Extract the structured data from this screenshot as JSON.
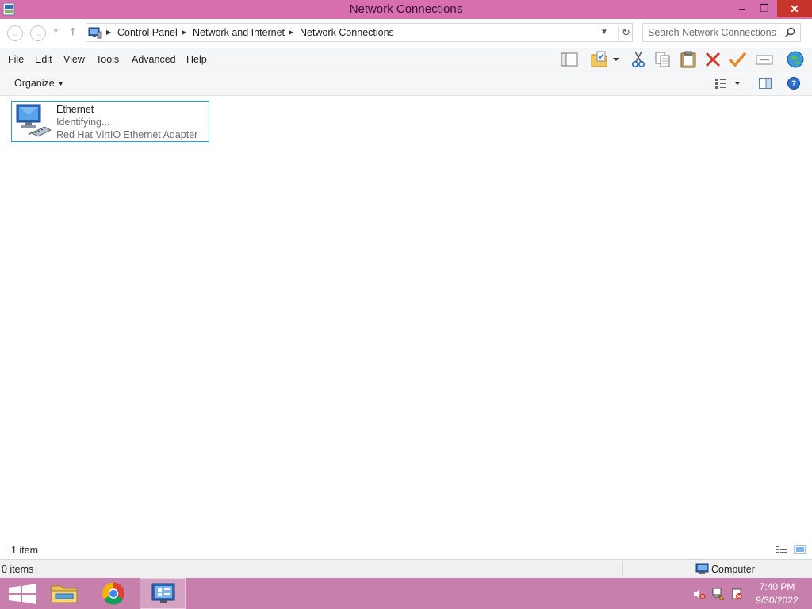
{
  "window": {
    "title": "Network Connections",
    "minimize_glyph": "–",
    "restore_glyph": "❐",
    "close_glyph": "✕"
  },
  "nav": {
    "back_glyph": "←",
    "forward_glyph": "→",
    "recent_glyph": "▼",
    "up_glyph": "↑",
    "refresh_glyph": "↻",
    "address_drop_glyph": "▼"
  },
  "breadcrumb": [
    "Control Panel",
    "Network and Internet",
    "Network Connections"
  ],
  "search": {
    "placeholder": "Search Network Connections"
  },
  "menu": [
    "File",
    "Edit",
    "View",
    "Tools",
    "Advanced",
    "Help"
  ],
  "toolbar_icons": [
    "layout-pane-icon",
    "folder-check-icon",
    "cut-icon",
    "copy-icon",
    "paste-icon",
    "delete-icon",
    "properties-check-icon",
    "rename-icon",
    "internet-globe-icon"
  ],
  "command": {
    "organize": "Organize",
    "caret": "▼"
  },
  "connection": {
    "name": "Ethernet",
    "status": "Identifying...",
    "device": "Red Hat VirtIO Ethernet Adapter"
  },
  "item_count": "1 item",
  "status_bar": {
    "items": "0 items",
    "location": "Computer"
  },
  "taskbar": {
    "apps": [
      "start-icon",
      "file-explorer-icon",
      "chrome-icon",
      "network-connections-icon"
    ]
  },
  "tray": {
    "icons": [
      "volume-muted-icon",
      "network-error-icon",
      "action-center-error-icon"
    ]
  },
  "clock": {
    "time": "7:40 PM",
    "date": "9/30/2022"
  },
  "colors": {
    "titlebar": "#d870b0",
    "taskbar": "#c77fae",
    "close": "#c6352b",
    "selection_border": "#26a0da"
  }
}
